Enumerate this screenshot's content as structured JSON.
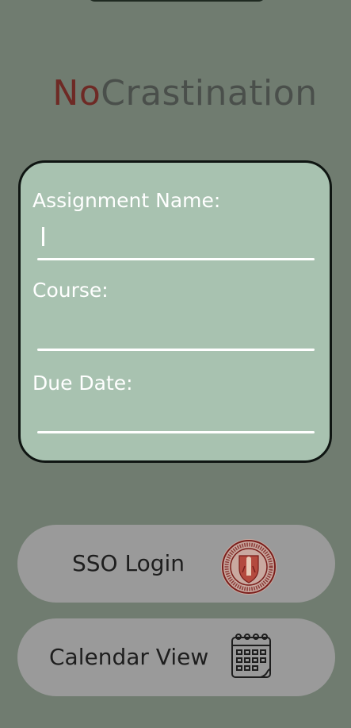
{
  "app": {
    "title_part1": "No",
    "title_part2": "Crastination"
  },
  "form": {
    "assignment_label": "Assignment Name:",
    "assignment_value": "",
    "course_label": "Course:",
    "course_value": "",
    "due_label": "Due Date:",
    "due_value": ""
  },
  "buttons": {
    "sso_label": "SSO Login",
    "calendar_label": "Calendar View"
  },
  "icons": {
    "sso": "university-seal-icon",
    "calendar": "calendar-icon"
  },
  "colors": {
    "background": "#707c70",
    "card": "#a8c2b0",
    "brand_red": "#6e2a25",
    "button": "#9a9a9a"
  }
}
